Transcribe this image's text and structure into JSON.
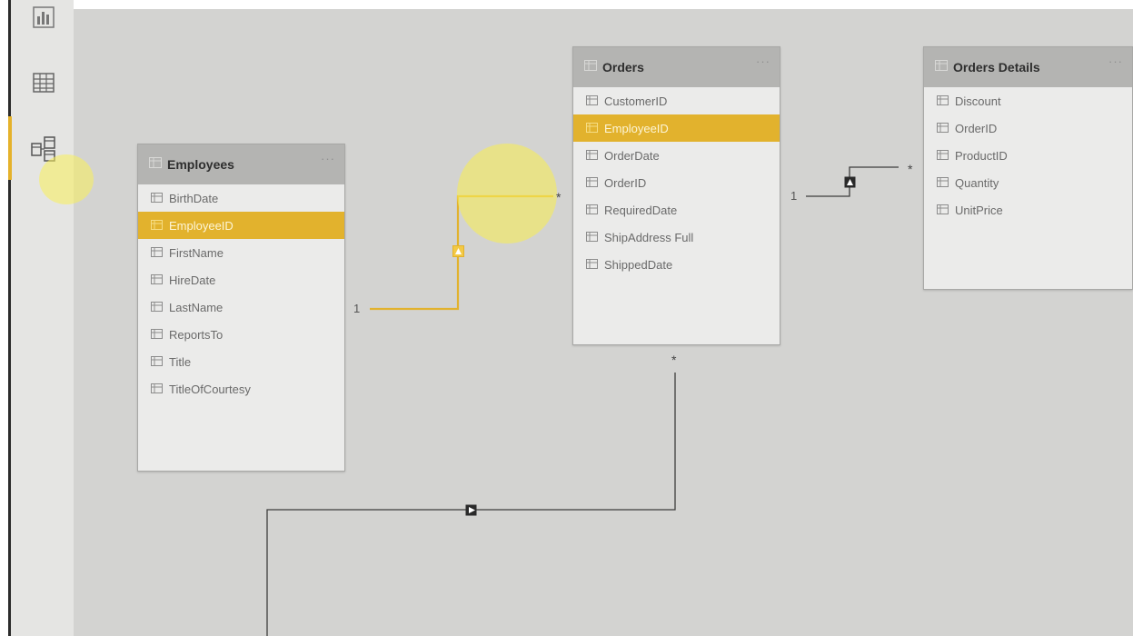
{
  "colors": {
    "highlight": "#e2b22d",
    "connector_active": "#e2b22d",
    "connector": "#3d3d3d",
    "header": "#b4b4b2"
  },
  "sidebar": {
    "items": [
      {
        "icon": "report-view-icon"
      },
      {
        "icon": "data-view-icon"
      },
      {
        "icon": "model-view-icon",
        "active": true
      }
    ]
  },
  "tables": {
    "employees": {
      "title": "Employees",
      "menu": "···",
      "fields": [
        "BirthDate",
        "EmployeeID",
        "FirstName",
        "HireDate",
        "LastName",
        "ReportsTo",
        "Title",
        "TitleOfCourtesy"
      ],
      "highlighted": "EmployeeID"
    },
    "orders": {
      "title": "Orders",
      "menu": "···",
      "fields": [
        "CustomerID",
        "EmployeeID",
        "OrderDate",
        "OrderID",
        "RequiredDate",
        "ShipAddress Full",
        "ShippedDate"
      ],
      "highlighted": "EmployeeID"
    },
    "orders_details": {
      "title": "Orders Details",
      "menu": "···",
      "fields": [
        "Discount",
        "OrderID",
        "ProductID",
        "Quantity",
        "UnitPrice"
      ]
    }
  },
  "relationships": {
    "employees_orders": {
      "one": "1",
      "many": "*"
    },
    "orders_details": {
      "one": "1",
      "many": "*"
    },
    "orders_bottom": {
      "many": "*"
    }
  }
}
